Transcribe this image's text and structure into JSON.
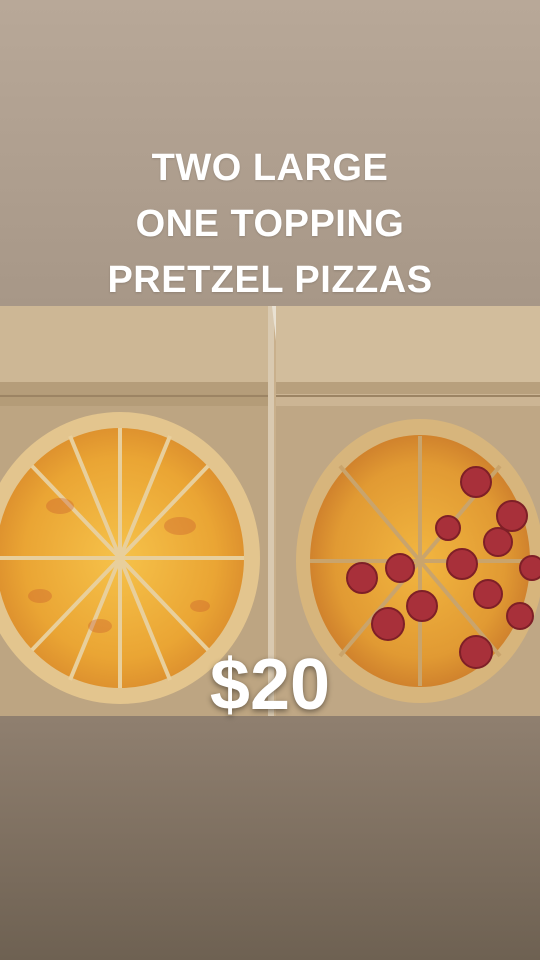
{
  "headline": {
    "line1": "TWO LARGE",
    "line2": "ONE TOPPING",
    "line3": "PRETZEL PIZZAS"
  },
  "price": "$20",
  "photo": {
    "subject": "cheese-and-pepperoni-pizzas-in-boxes"
  },
  "colors": {
    "background_top": "#b8a898",
    "background_bottom": "#6e6152",
    "text": "#ffffff",
    "cheese": "#f0b03a",
    "crust": "#e3c58e",
    "pepperoni": "#b3373a",
    "box": "#c9b08c"
  }
}
